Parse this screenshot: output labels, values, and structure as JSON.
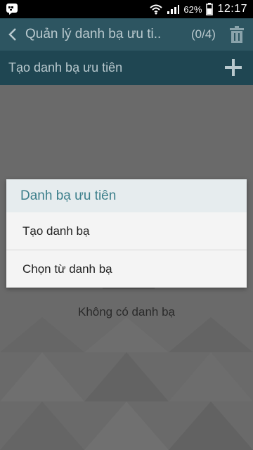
{
  "status": {
    "battery": "62%",
    "time": "12:17"
  },
  "header": {
    "title": "Quản lý danh bạ ưu ti..",
    "count": "(0/4)"
  },
  "create_bar": {
    "label": "Tạo danh bạ ưu tiên"
  },
  "content": {
    "empty_text": "Không có danh bạ"
  },
  "dialog": {
    "title": "Danh bạ ưu tiên",
    "options": [
      "Tạo danh bạ",
      "Chọn từ danh bạ"
    ]
  },
  "colors": {
    "title_bar": "#2d5561",
    "create_bar": "#1f4652",
    "dialog_title_text": "#3c7f8b"
  },
  "icons": {
    "status_left": "messenger-icon",
    "status_wifi": "wifi-icon",
    "status_signal": "signal-icon",
    "status_battery": "battery-icon",
    "back": "chevron-left-icon",
    "trash": "trash-icon",
    "plus": "plus-icon"
  }
}
